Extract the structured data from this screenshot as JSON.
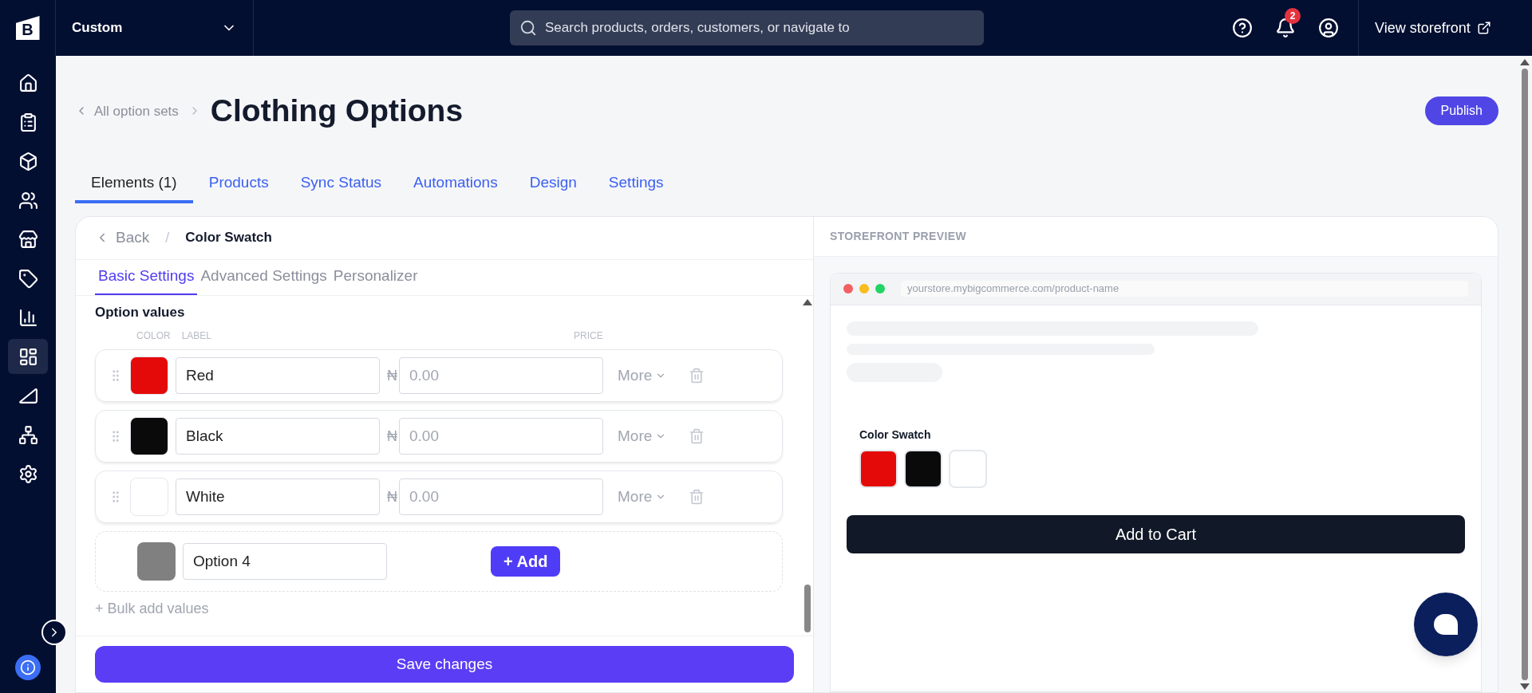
{
  "topbar": {
    "logo_text": "B",
    "store": "Custom",
    "search": {
      "placeholder": "Search products, orders, customers, or navigate to"
    },
    "notifications_count": "2",
    "storefront_link": "View storefront"
  },
  "sidebar": {
    "items": [
      {
        "selected": false
      },
      {
        "selected": false
      },
      {
        "selected": false
      },
      {
        "selected": false
      },
      {
        "selected": false
      },
      {
        "selected": false
      },
      {
        "selected": false
      },
      {
        "selected": true
      },
      {
        "selected": false
      },
      {
        "selected": false
      },
      {
        "selected": false
      }
    ]
  },
  "breadcrumb": "All option sets",
  "title": "Clothing Options",
  "publish_button": "Publish",
  "tabs": [
    {
      "label": "Elements (1)",
      "selected": true
    },
    {
      "label": "Products",
      "selected": false
    },
    {
      "label": "Sync Status",
      "selected": false
    },
    {
      "label": "Automations",
      "selected": false
    },
    {
      "label": "Design",
      "selected": false
    },
    {
      "label": "Settings",
      "selected": false
    }
  ],
  "editor": {
    "back": "Back",
    "separator": "/",
    "element_name": "Color Swatch",
    "subtabs": [
      {
        "label": "Basic Settings",
        "selected": true
      },
      {
        "label": "Advanced Settings",
        "selected": false
      },
      {
        "label": "Personalizer",
        "selected": false
      }
    ],
    "section_title": "Option values",
    "columns": [
      "COLOR",
      "LABEL",
      "PRICE"
    ],
    "values": [
      {
        "color": "#e50a0a",
        "label": "Red",
        "currency": "₦",
        "price_placeholder": "0.00",
        "more": "More"
      },
      {
        "color": "#0a0a0a",
        "label": "Black",
        "currency": "₦",
        "price_placeholder": "0.00",
        "more": "More"
      },
      {
        "color": "#ffffff",
        "label": "White",
        "currency": "₦",
        "price_placeholder": "0.00",
        "more": "More"
      }
    ],
    "new_value": {
      "color": "#808080",
      "label": "Option 4",
      "add_button": "+ Add"
    },
    "bulk_add": "+ Bulk add values",
    "save_button": "Save changes"
  },
  "preview": {
    "heading": "STOREFRONT PREVIEW",
    "url": "yourstore.mybigcommerce.com/product-name",
    "swatch_label": "Color Swatch",
    "swatches": [
      {
        "color": "#e50a0a"
      },
      {
        "color": "#0a0a0a"
      },
      {
        "color": "#ffffff"
      }
    ],
    "cart_button": "Add to Cart"
  }
}
